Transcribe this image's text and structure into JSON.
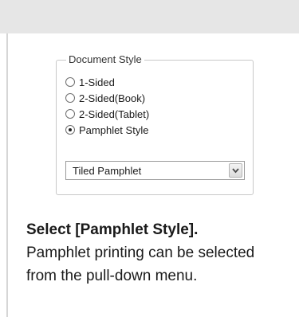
{
  "document_style": {
    "legend": "Document Style",
    "options": [
      {
        "label": "1-Sided",
        "selected": false
      },
      {
        "label": "2-Sided(Book)",
        "selected": false
      },
      {
        "label": "2-Sided(Tablet)",
        "selected": false
      },
      {
        "label": "Pamphlet Style",
        "selected": true
      }
    ],
    "dropdown": {
      "value": "Tiled Pamphlet",
      "icon": "chevron-down-icon"
    }
  },
  "instruction": {
    "heading": "Select [Pamphlet Style].",
    "body": "Pamphlet printing can be selected from the pull-down menu."
  }
}
